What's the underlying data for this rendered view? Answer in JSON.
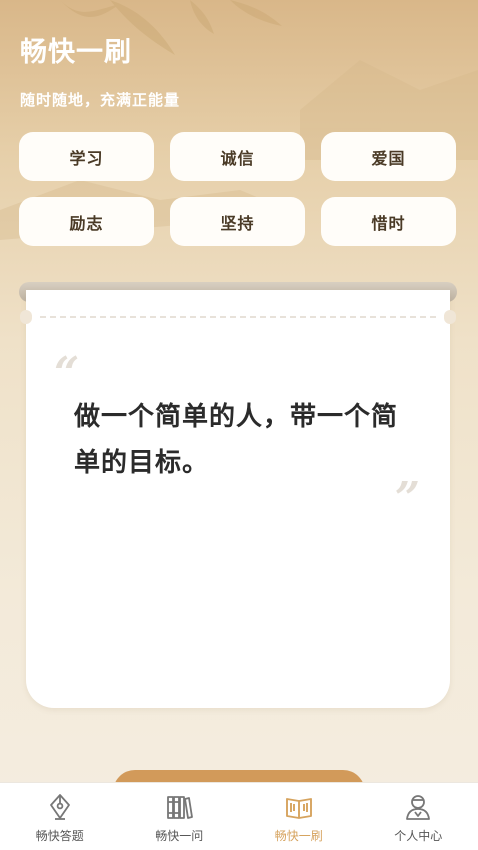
{
  "header": {
    "title": "畅快一刷",
    "subtitle": "随时随地，充满正能量"
  },
  "tags": [
    {
      "label": "学习",
      "active": false
    },
    {
      "label": "诚信",
      "active": false
    },
    {
      "label": "爱国",
      "active": false
    },
    {
      "label": "励志",
      "active": false
    },
    {
      "label": "坚持",
      "active": false
    },
    {
      "label": "惜时",
      "active": true
    }
  ],
  "card": {
    "open_quote": "“",
    "close_quote": "”",
    "text": "做一个简单的人，带一个简单的目标。"
  },
  "tabbar": {
    "items": [
      {
        "label": "畅快答题",
        "icon": "pen-nib-icon",
        "active": false
      },
      {
        "label": "畅快一问",
        "icon": "books-icon",
        "active": false
      },
      {
        "label": "畅快一刷",
        "icon": "open-book-icon",
        "active": true
      },
      {
        "label": "个人中心",
        "icon": "user-icon",
        "active": false
      }
    ]
  },
  "colors": {
    "accent": "#d39a57",
    "tab_active": "#d6a35e"
  }
}
